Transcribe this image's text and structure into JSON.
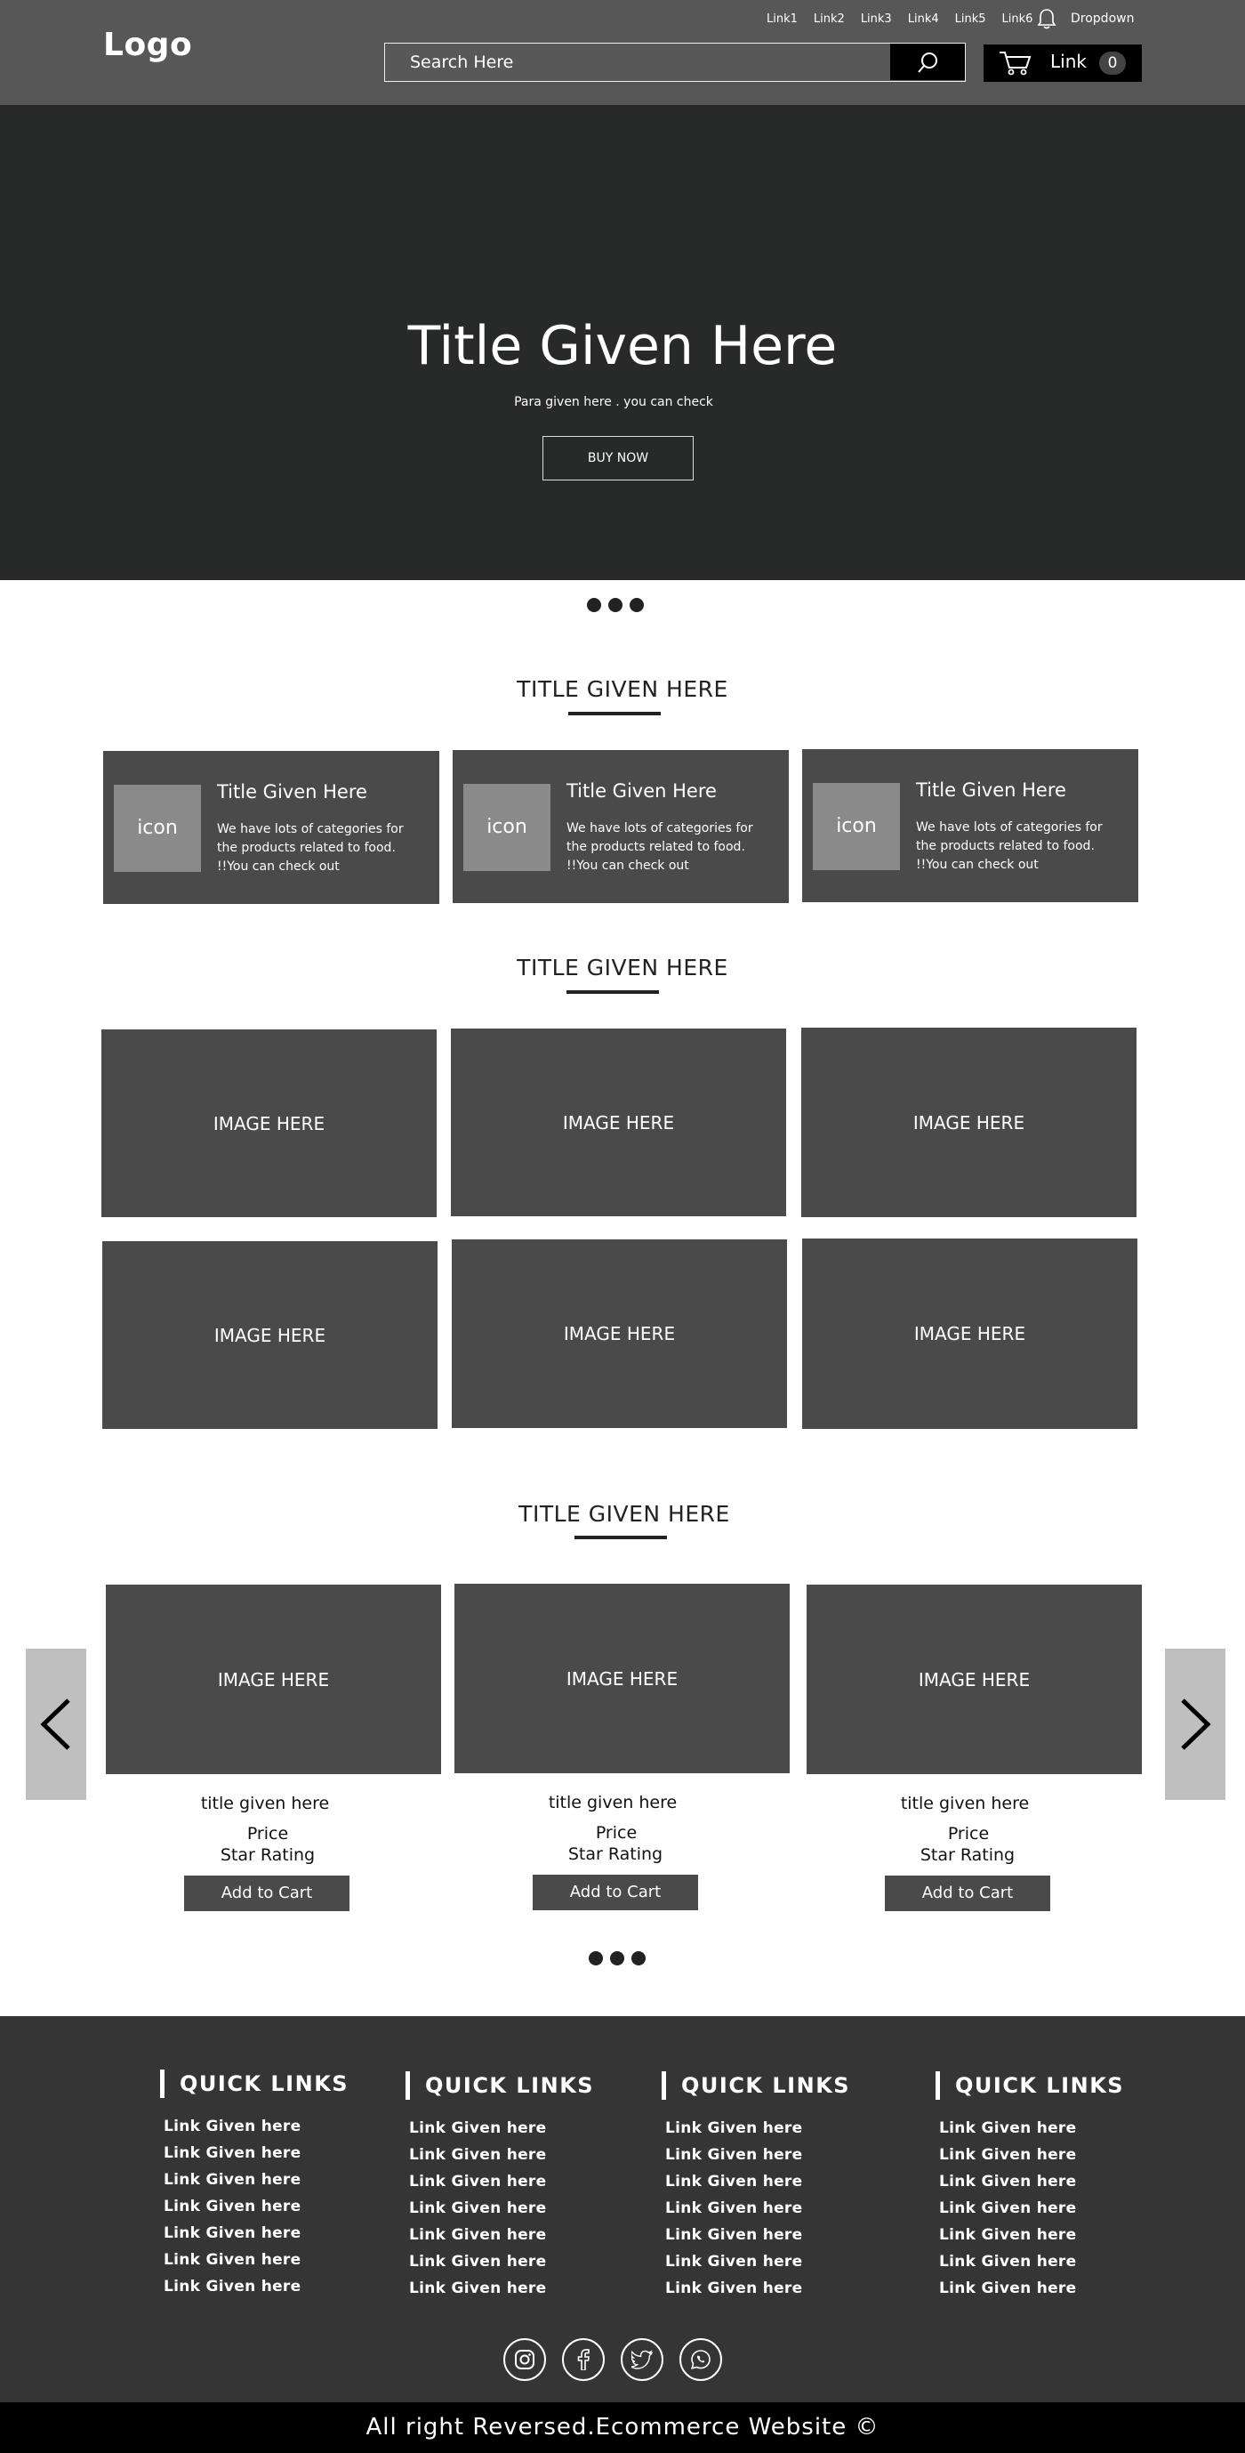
{
  "header": {
    "logo": "Logo",
    "top_links": [
      "Link1",
      "Link2",
      "Link3",
      "Link4",
      "Link5",
      "Link6"
    ],
    "dropdown_label": "Dropdown",
    "search_placeholder": "Search Here",
    "cart_label": "Link",
    "cart_count": "0"
  },
  "hero": {
    "title": "Title Given Here",
    "para": "Para given here . you can check",
    "button": "BUY NOW"
  },
  "categories": {
    "title": "TITLE GIVEN HERE",
    "cards": [
      {
        "icon": "icon",
        "title": "Title Given Here",
        "text": "We have lots of categories for the products related to food. !!You can check out"
      },
      {
        "icon": "icon",
        "title": "Title Given Here",
        "text": "We have lots of categories for the products related to food. !!You can check out"
      },
      {
        "icon": "icon",
        "title": "Title Given Here",
        "text": "We have lots of categories for the products related to food. !!You can check out"
      }
    ]
  },
  "gallery": {
    "title": "TITLE GIVEN HERE",
    "images": [
      "IMAGE HERE",
      "IMAGE HERE",
      "IMAGE HERE",
      "IMAGE HERE",
      "IMAGE HERE",
      "IMAGE HERE"
    ]
  },
  "products": {
    "title": "TITLE GIVEN HERE",
    "items": [
      {
        "image": "IMAGE HERE",
        "title": "title given here",
        "price": "Price",
        "rating": "Star Rating",
        "button": "Add to Cart"
      },
      {
        "image": "IMAGE HERE",
        "title": "title given here",
        "price": "Price",
        "rating": "Star Rating",
        "button": "Add to Cart"
      },
      {
        "image": "IMAGE HERE",
        "title": "title given here",
        "price": "Price",
        "rating": "Star Rating",
        "button": "Add to Cart"
      }
    ]
  },
  "footer": {
    "columns": [
      {
        "heading": "QUICK LINKS",
        "links": [
          "Link Given here",
          "Link Given here",
          "Link Given here",
          "Link Given here",
          "Link Given here",
          "Link Given here",
          "Link Given here"
        ]
      },
      {
        "heading": "QUICK LINKS",
        "links": [
          "Link Given here",
          "Link Given here",
          "Link Given here",
          "Link Given here",
          "Link Given here",
          "Link Given here",
          "Link Given here"
        ]
      },
      {
        "heading": "QUICK LINKS",
        "links": [
          "Link Given here",
          "Link Given here",
          "Link Given here",
          "Link Given here",
          "Link Given here",
          "Link Given here",
          "Link Given here"
        ]
      },
      {
        "heading": "QUICK LINKS",
        "links": [
          "Link Given here",
          "Link Given here",
          "Link Given here",
          "Link Given here",
          "Link Given here",
          "Link Given here",
          "Link Given here"
        ]
      }
    ],
    "socials": [
      "instagram-icon",
      "facebook-icon",
      "twitter-icon",
      "whatsapp-icon"
    ],
    "copyright": "All right Reversed.Ecommerce Website ©"
  }
}
